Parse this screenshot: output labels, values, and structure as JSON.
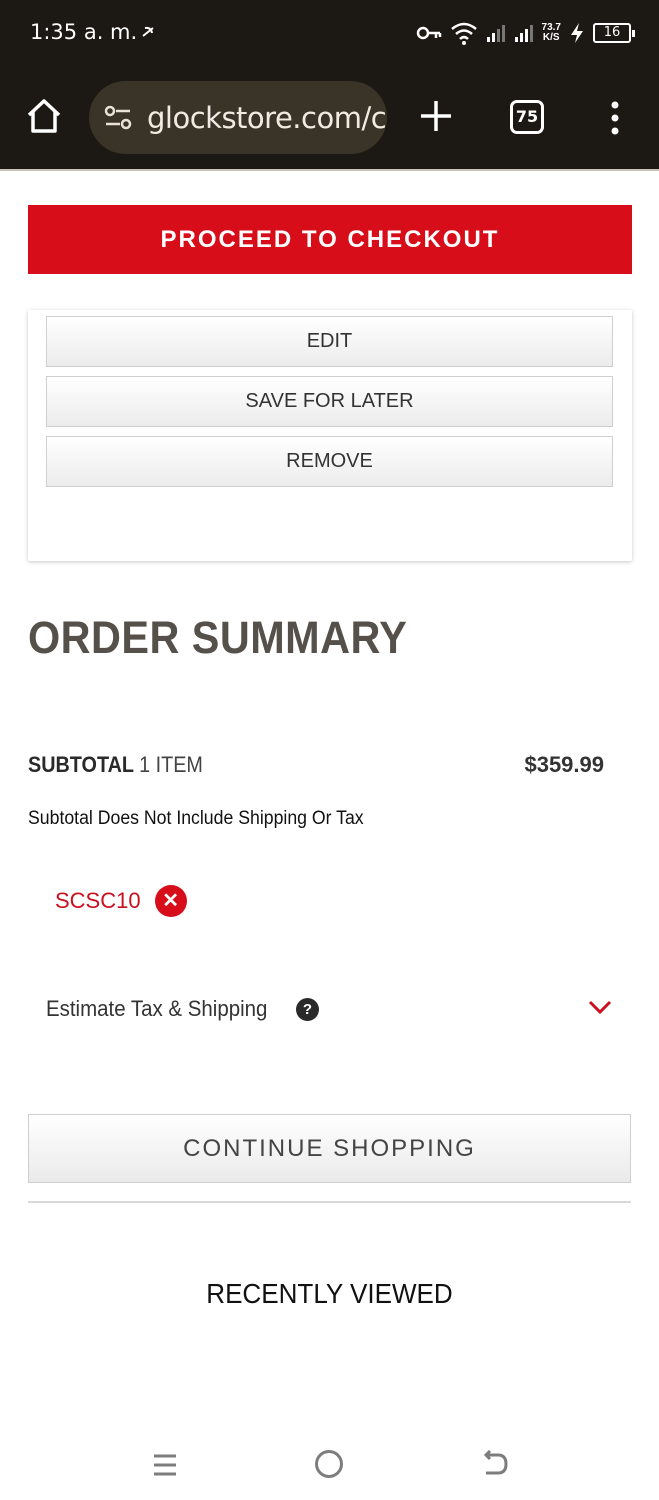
{
  "status_bar": {
    "time": "1:35 a. m.",
    "network_speed": "73.7",
    "network_unit": "K/S",
    "battery": "16"
  },
  "browser": {
    "url": "glockstore.com/c",
    "tab_count": "75"
  },
  "checkout": {
    "label": "PROCEED TO CHECKOUT"
  },
  "item_actions": {
    "edit": "EDIT",
    "save_for_later": "SAVE FOR LATER",
    "remove": "REMOVE"
  },
  "order_summary": {
    "title": "ORDER SUMMARY",
    "subtotal_label": "SUBTOTAL",
    "subtotal_count": "1 ITEM",
    "subtotal_amount": "$359.99",
    "subtotal_note": "Subtotal Does Not Include Shipping Or Tax",
    "promo_code": "SCSC10",
    "estimate_label": "Estimate Tax & Shipping"
  },
  "continue": {
    "label": "CONTINUE SHOPPING"
  },
  "recently_viewed": {
    "title": "RECENTLY VIEWED"
  },
  "colors": {
    "brand_red": "#d70d19",
    "toolbar_bg": "#1c1813",
    "heading_gray": "#555049"
  },
  "icons": [
    "home-icon",
    "site-settings-icon",
    "new-tab-icon",
    "tabs-icon",
    "more-menu-icon",
    "remove-promo-icon",
    "help-icon",
    "chevron-down-icon",
    "nav-menu-icon",
    "nav-home-icon",
    "nav-back-icon"
  ]
}
